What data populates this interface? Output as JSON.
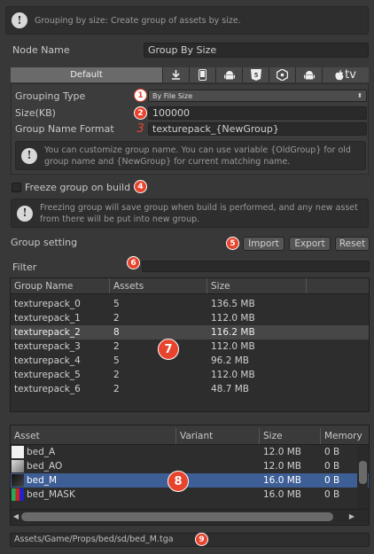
{
  "top_help": {
    "text": "Grouping by size: Create group of assets by size."
  },
  "node_name": {
    "label": "Node Name",
    "value": "Group By Size"
  },
  "platform_tabs": [
    {
      "label": "Default",
      "icon": ""
    },
    {
      "label": "",
      "icon": "download-icon"
    },
    {
      "label": "",
      "icon": "ios-device-icon"
    },
    {
      "label": "",
      "icon": "android-icon"
    },
    {
      "label": "",
      "icon": "html5-icon"
    },
    {
      "label": "",
      "icon": "unity-icon"
    },
    {
      "label": "",
      "icon": "android-icon"
    },
    {
      "label": "tv",
      "icon": "apple-tv-icon"
    }
  ],
  "grouping": {
    "type_label": "Grouping Type",
    "type_value": "By File Size",
    "size_label": "Size(KB)",
    "size_value": "100000",
    "format_label": "Group Name Format",
    "format_value": "texturepack_{NewGroup}",
    "help": "You can customize group name. You can use variable {OldGroup} for old group name and {NewGroup} for current matching name."
  },
  "freeze": {
    "label": "Freeze group on build",
    "checked": false,
    "help": "Freezing group will save group when build is performed, and any new asset from there will be put into new group."
  },
  "group_setting": {
    "label": "Group setting",
    "import_label": "Import",
    "export_label": "Export",
    "reset_label": "Reset"
  },
  "filter": {
    "label": "Filter",
    "value": ""
  },
  "groups_table": {
    "columns": [
      "Group Name",
      "Assets",
      "Size"
    ],
    "rows": [
      [
        "texturepack_0",
        "5",
        "136.5 MB"
      ],
      [
        "texturepack_1",
        "2",
        "112.0 MB"
      ],
      [
        "texturepack_2",
        "8",
        "116.2 MB"
      ],
      [
        "texturepack_3",
        "2",
        "112.0 MB"
      ],
      [
        "texturepack_4",
        "5",
        "96.2 MB"
      ],
      [
        "texturepack_5",
        "2",
        "112.0 MB"
      ],
      [
        "texturepack_6",
        "2",
        "48.7 MB"
      ]
    ]
  },
  "assets_table": {
    "columns": [
      "Asset",
      "Variant",
      "Size",
      "Memory"
    ],
    "rows": [
      [
        "bed_A",
        "",
        "12.0 MB",
        "0 B"
      ],
      [
        "bed_AO",
        "",
        "12.0 MB",
        "0 B"
      ],
      [
        "bed_M",
        "",
        "16.0 MB",
        "0 B"
      ],
      [
        "bed_MASK",
        "",
        "16.0 MB",
        "0 B"
      ]
    ]
  },
  "path": {
    "value": "Assets/Game/Props/bed/sd/bed_M.tga"
  },
  "markers": [
    "1",
    "2",
    "3",
    "4",
    "5",
    "6",
    "7",
    "8",
    "9"
  ],
  "colors": {
    "accent_marker": "#e8432d",
    "selection": "#3e5f96"
  }
}
